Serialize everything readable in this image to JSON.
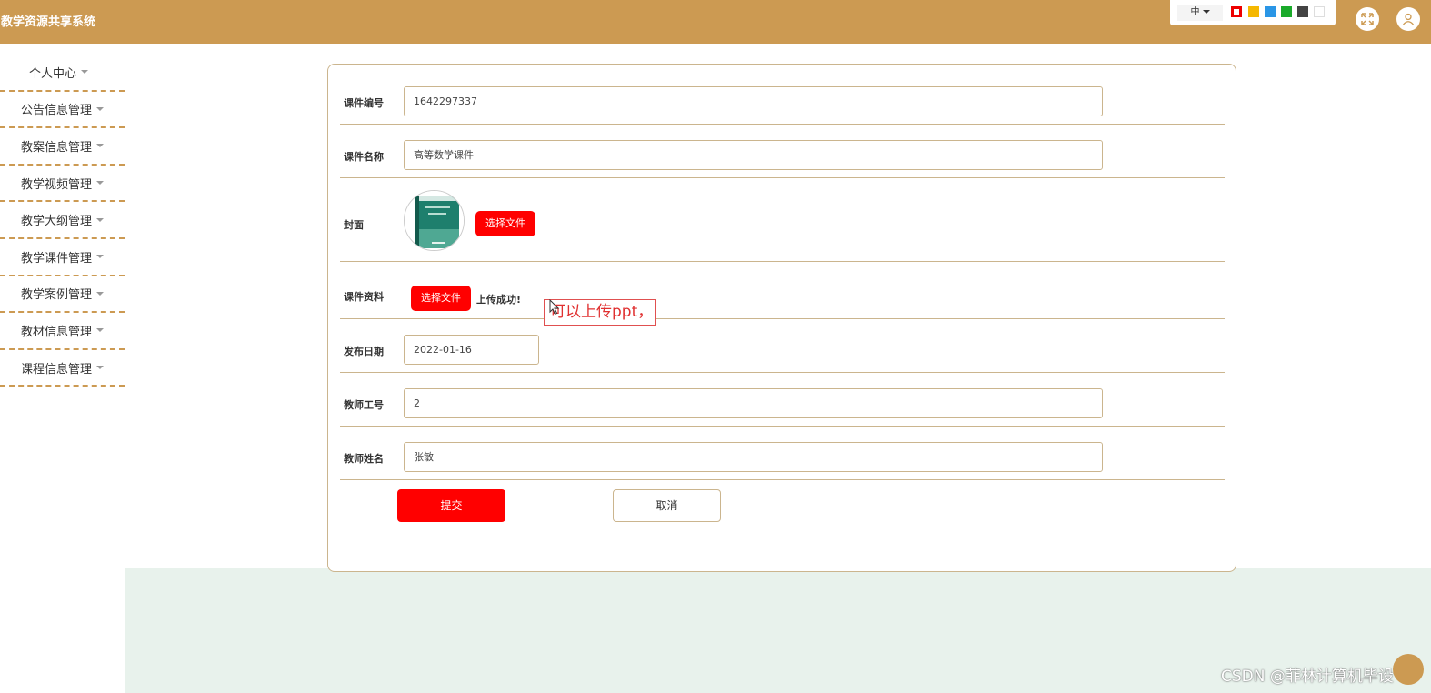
{
  "app": {
    "title": "教学资源共享系统"
  },
  "header": {
    "language": "中",
    "theme_colors": [
      "#ee0000",
      "#f5b800",
      "#2a96e6",
      "#1aaa2a",
      "#444444",
      "#ffffff"
    ],
    "icons": [
      "fullscreen-icon",
      "user-icon"
    ]
  },
  "sidebar": {
    "items": [
      {
        "label": "个人中心"
      },
      {
        "label": "公告信息管理"
      },
      {
        "label": "教案信息管理"
      },
      {
        "label": "教学视频管理"
      },
      {
        "label": "教学大纲管理"
      },
      {
        "label": "教学课件管理"
      },
      {
        "label": "教学案例管理"
      },
      {
        "label": "教材信息管理"
      },
      {
        "label": "课程信息管理"
      }
    ]
  },
  "form": {
    "courseware_no": {
      "label": "课件编号",
      "value": "1642297337"
    },
    "courseware_name": {
      "label": "课件名称",
      "value": "高等数学课件"
    },
    "cover": {
      "label": "封面",
      "button": "选择文件"
    },
    "material": {
      "label": "课件资料",
      "button": "选择文件",
      "status": "上传成功!"
    },
    "publish_date": {
      "label": "发布日期",
      "value": "2022-01-16"
    },
    "teacher_no": {
      "label": "教师工号",
      "value": "2"
    },
    "teacher_name": {
      "label": "教师姓名",
      "value": "张敏"
    },
    "submit": "提交",
    "cancel": "取消"
  },
  "annotation": {
    "text": "可以上传ppt，|"
  },
  "watermark": "CSDN @菲林计算机毕设",
  "colors": {
    "brand": "#cc9a52",
    "primary_button": "#ff0000",
    "footer": "#e8f2ec"
  }
}
